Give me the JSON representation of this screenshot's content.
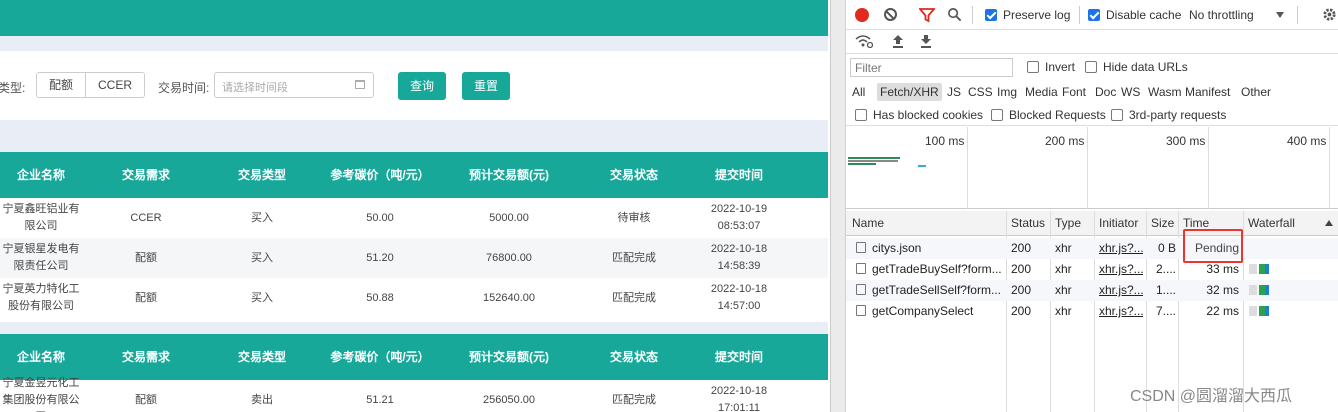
{
  "webpage": {
    "filter": {
      "type_label": "类型:",
      "type_options": [
        "配额",
        "CCER"
      ],
      "time_label": "交易时间:",
      "time_placeholder": "请选择时间段",
      "query_button": "查询",
      "reset_button": "重置"
    },
    "columns": [
      "企业名称",
      "交易需求",
      "交易类型",
      "参考碳价（吨/元）",
      "预计交易额(元)",
      "交易状态",
      "提交时间"
    ],
    "table1_rows": [
      [
        "宁夏鑫旺铝业有限公司",
        "CCER",
        "买入",
        "50.00",
        "5000.00",
        "待审核",
        "2022-10-19 08:53:07"
      ],
      [
        "宁夏银星发电有限责任公司",
        "配额",
        "买入",
        "51.20",
        "76800.00",
        "匹配完成",
        "2022-10-18 14:58:39"
      ],
      [
        "宁夏英力特化工股份有限公司",
        "配额",
        "买入",
        "50.88",
        "152640.00",
        "匹配完成",
        "2022-10-18 14:57:00"
      ]
    ],
    "table2_rows": [
      [
        "宁夏金昱元化工集团股份有限公司",
        "配额",
        "卖出",
        "51.21",
        "256050.00",
        "匹配完成",
        "2022-10-18 17:01:11"
      ]
    ]
  },
  "devtools": {
    "toolbar": {
      "preserve_log": "Preserve log",
      "disable_cache": "Disable cache",
      "throttling": "No throttling"
    },
    "filter_placeholder": "Filter",
    "invert_label": "Invert",
    "hide_data_urls_label": "Hide data URLs",
    "type_filters": [
      "All",
      "Fetch/XHR",
      "JS",
      "CSS",
      "Img",
      "Media",
      "Font",
      "Doc",
      "WS",
      "Wasm",
      "Manifest",
      "Other"
    ],
    "selected_type": "Fetch/XHR",
    "has_blocked_cookies": "Has blocked cookies",
    "blocked_requests": "Blocked Requests",
    "third_party": "3rd-party requests",
    "overview_ticks": [
      "100 ms",
      "200 ms",
      "300 ms",
      "400 ms"
    ],
    "table_headers": [
      "Name",
      "Status",
      "Type",
      "Initiator",
      "Size",
      "Time",
      "Waterfall"
    ],
    "requests": [
      {
        "name": "citys.json",
        "status": "200",
        "type": "xhr",
        "initiator": "xhr.js?...",
        "size": "0 B",
        "time": "Pending"
      },
      {
        "name": "getTradeBuySelf?form...",
        "status": "200",
        "type": "xhr",
        "initiator": "xhr.js?...",
        "size": "2....",
        "time": "33 ms"
      },
      {
        "name": "getTradeSellSelf?form...",
        "status": "200",
        "type": "xhr",
        "initiator": "xhr.js?...",
        "size": "1....",
        "time": "32 ms"
      },
      {
        "name": "getCompanySelect",
        "status": "200",
        "type": "xhr",
        "initiator": "xhr.js?...",
        "size": "7....",
        "time": "22 ms"
      }
    ]
  },
  "watermark": "CSDN @圆溜溜大西瓜",
  "colors": {
    "teal": "#17a89a",
    "record_red": "#e0291f",
    "checkbox_blue": "#1a73e8",
    "highlight_red": "#e33"
  }
}
